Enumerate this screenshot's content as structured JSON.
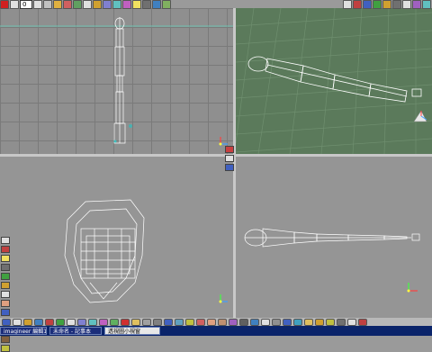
{
  "app": {
    "frame_field": "0"
  },
  "taskbar": {
    "items": [
      {
        "label": "imagineer 編輯1"
      },
      {
        "label": "未命名 - 記事本"
      },
      {
        "label": "透視圖小視窗"
      }
    ]
  },
  "colors": {
    "perspective_bg": "#5b7a5b",
    "ortho_bg": "#8f8f8f",
    "wire": "#ffffff",
    "taskbar": "#0a246a"
  },
  "icons": {
    "top_toolbar": [
      "record-icon",
      "stop-icon",
      "play-icon",
      "rewind-icon",
      "key-icon",
      "magnet-icon",
      "grid-icon",
      "eye-icon",
      "pencil-icon",
      "move-icon",
      "rotate-icon",
      "scale-icon",
      "light-icon",
      "camera-icon",
      "render-icon",
      "layers-icon"
    ],
    "persp_toolbar": [
      "render-icon",
      "shade-icon",
      "wire-icon",
      "color-icon",
      "tex-icon",
      "cam-icon",
      "zoom-icon",
      "pan-icon",
      "orbit-icon",
      "fit-icon"
    ],
    "left_toolbar": [
      "layer-icon",
      "object-icon",
      "light-icon",
      "camera-icon",
      "material-icon",
      "texture-icon",
      "bone-icon",
      "skin-icon",
      "morph-icon",
      "particle-icon",
      "cloth-icon",
      "hair-icon",
      "fx-icon"
    ],
    "bottom_toolbar": [
      "help-icon",
      "new-icon",
      "open-icon",
      "save-icon",
      "undo-icon",
      "redo-icon",
      "select-icon",
      "move-icon",
      "rotate-icon",
      "scale-icon",
      "add-icon",
      "delete-icon",
      "group-icon",
      "link-icon",
      "unlink-icon",
      "mirror-icon",
      "array-icon",
      "align-icon",
      "snap-icon",
      "face-icon",
      "figure-icon",
      "paint-icon",
      "sculpt-icon",
      "render-icon",
      "preview-icon",
      "settings-icon",
      "info-icon",
      "web-icon",
      "mail-icon",
      "folder-icon",
      "lock-icon",
      "hide-icon",
      "show-icon",
      "exit-icon"
    ]
  }
}
